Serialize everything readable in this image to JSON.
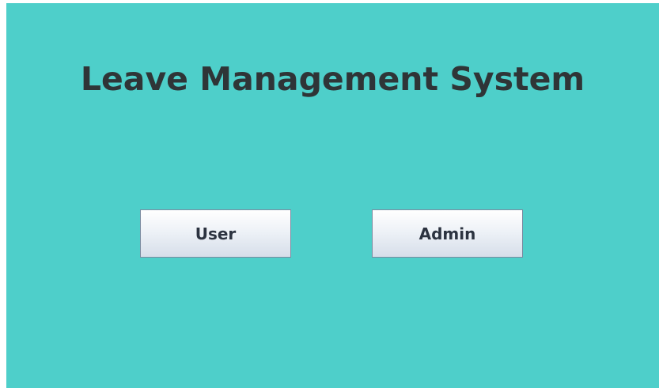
{
  "app": {
    "title": "Leave Management System"
  },
  "buttons": {
    "user_label": "User",
    "admin_label": "Admin"
  },
  "colors": {
    "background": "#4ecfca",
    "title_text": "#2f3537",
    "button_border": "#7a8ba0"
  }
}
